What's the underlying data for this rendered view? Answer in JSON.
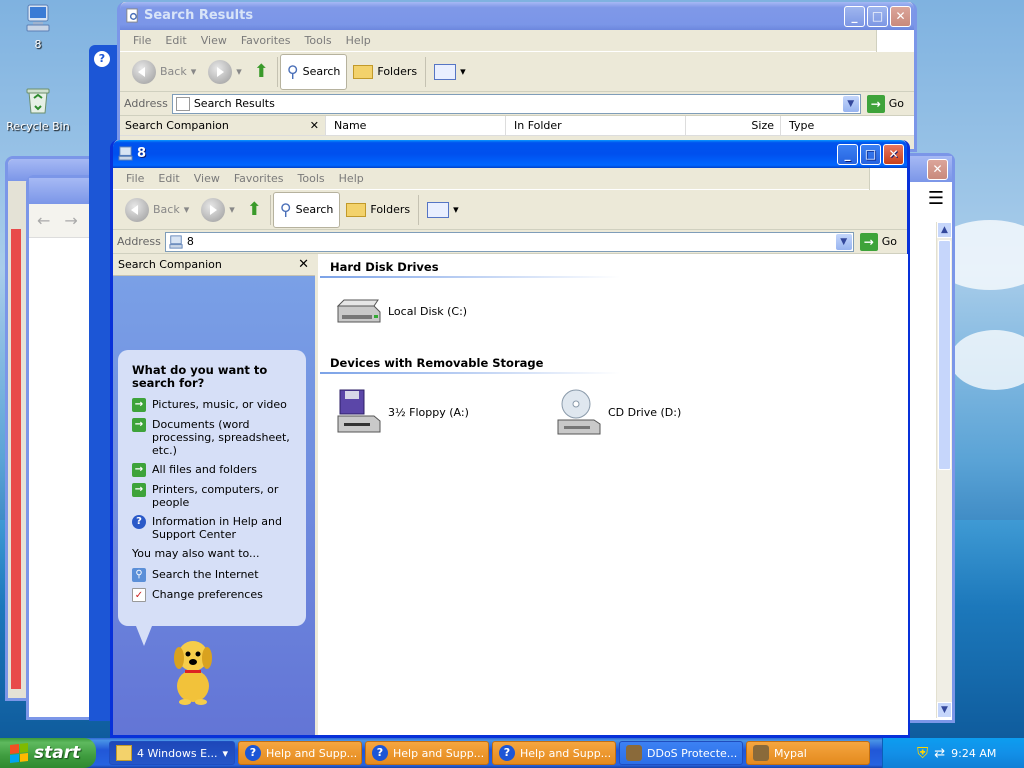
{
  "desktop": {
    "icons": [
      {
        "label": "8"
      },
      {
        "label": "Recycle Bin"
      }
    ]
  },
  "search_window": {
    "title": "Search Results",
    "menu": [
      "File",
      "Edit",
      "View",
      "Favorites",
      "Tools",
      "Help"
    ],
    "toolbar": {
      "back": "Back",
      "search": "Search",
      "folders": "Folders"
    },
    "address_label": "Address",
    "address_value": "Search Results",
    "go": "Go",
    "pane_title": "Search Companion",
    "columns": [
      "Name",
      "In Folder",
      "Size",
      "Type"
    ]
  },
  "main_window": {
    "title": "8",
    "menu": [
      "File",
      "Edit",
      "View",
      "Favorites",
      "Tools",
      "Help"
    ],
    "toolbar": {
      "back": "Back",
      "search": "Search",
      "folders": "Folders"
    },
    "address_label": "Address",
    "address_value": "8",
    "go": "Go",
    "pane": {
      "title": "Search Companion",
      "question": "What do you want to search for?",
      "options": [
        "Pictures, music, or video",
        "Documents (word processing, spreadsheet, etc.)",
        "All files and folders",
        "Printers, computers, or people",
        "Information in Help and Support Center"
      ],
      "also_label": "You may also want to...",
      "also_options": [
        "Search the Internet",
        "Change preferences"
      ]
    },
    "groups": [
      {
        "title": "Hard Disk Drives",
        "items": [
          "Local Disk (C:)"
        ]
      },
      {
        "title": "Devices with Removable Storage",
        "items": [
          "3½ Floppy (A:)",
          "CD Drive (D:)"
        ]
      }
    ]
  },
  "taskbar": {
    "start": "start",
    "tasks": [
      {
        "label": "4 Windows E..."
      },
      {
        "label": "Help and Supp..."
      },
      {
        "label": "Help and Supp..."
      },
      {
        "label": "Help and Supp..."
      },
      {
        "label": "DDoS Protecte..."
      },
      {
        "label": "Mypal"
      }
    ],
    "clock": "9:24 AM"
  }
}
